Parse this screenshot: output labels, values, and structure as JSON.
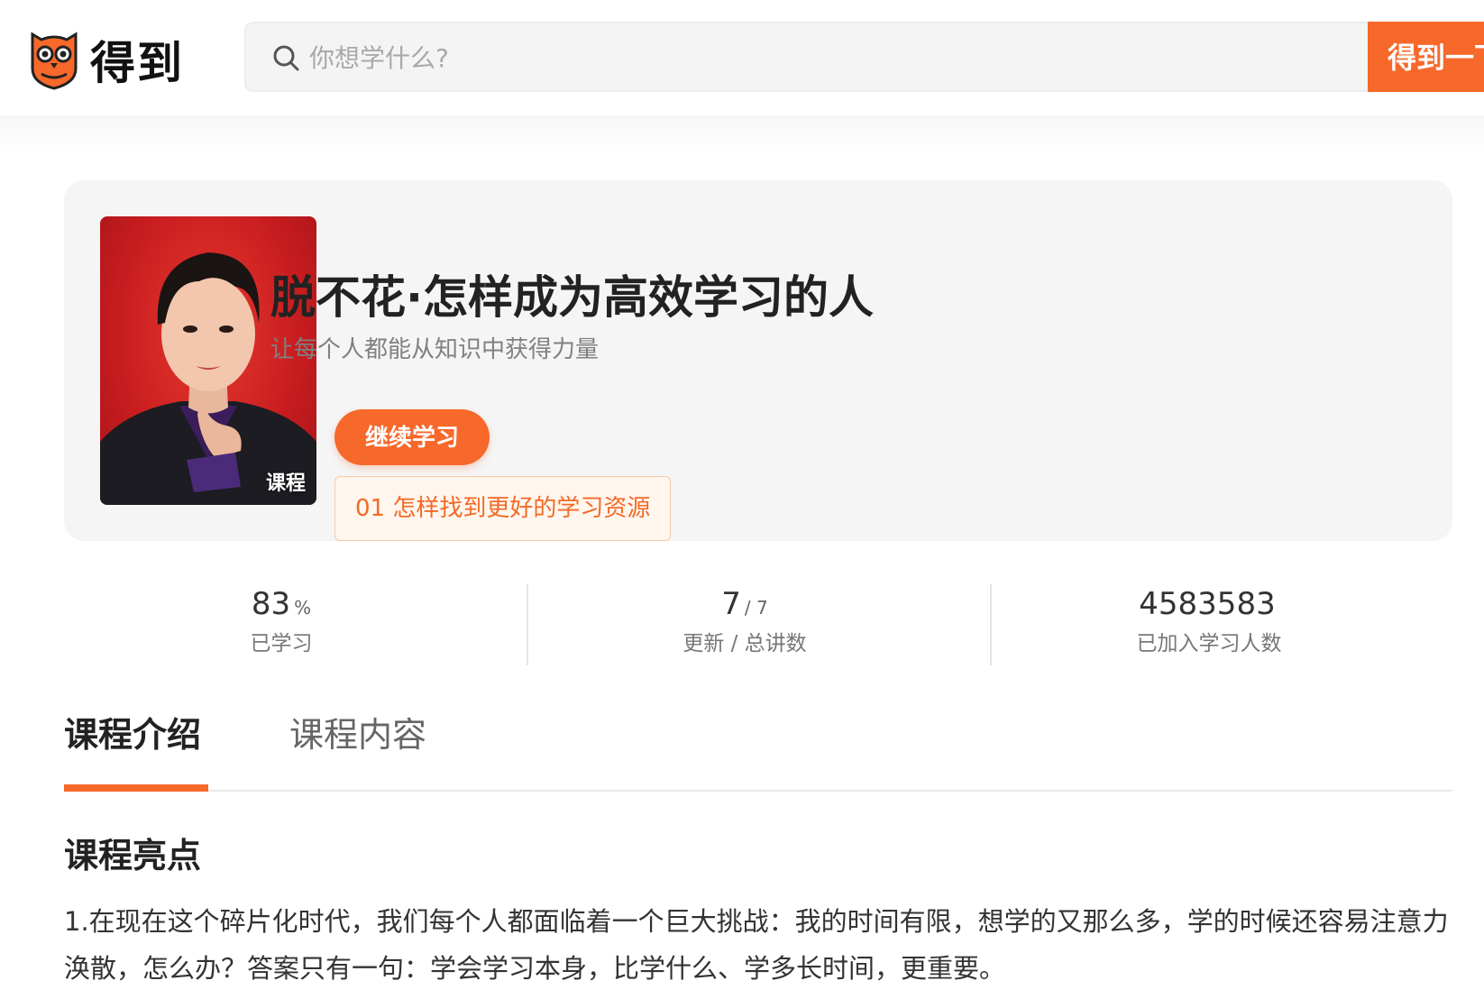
{
  "header": {
    "logo_text": "得到",
    "search_placeholder": "你想学什么?",
    "search_button_label": "得到一下"
  },
  "course": {
    "cover_badge": "课程",
    "title": "脱不花·怎样成为高效学习的人",
    "subtitle": "让每个人都能从知识中获得力量",
    "continue_label": "继续学习",
    "last_lesson": "01 怎样找到更好的学习资源"
  },
  "stats": [
    {
      "value": "83",
      "unit": "%",
      "label": "已学习"
    },
    {
      "value": "7",
      "unit": "/ 7",
      "label": "更新 / 总讲数"
    },
    {
      "value": "4583583",
      "unit": "",
      "label": "已加入学习人数"
    }
  ],
  "tabs": [
    {
      "label": "课程介绍",
      "active": true
    },
    {
      "label": "课程内容",
      "active": false
    }
  ],
  "section": {
    "title": "课程亮点",
    "body": "1.在现在这个碎片化时代，我们每个人都面临着一个巨大挑战：我的时间有限，想学的又那么多，学的时候还容易注意力涣散，怎么办？答案只有一句：学会学习本身，比学什么、学多长时间，更重要。"
  },
  "colors": {
    "accent": "#f7682b",
    "card_bg": "#f5f5f5"
  }
}
